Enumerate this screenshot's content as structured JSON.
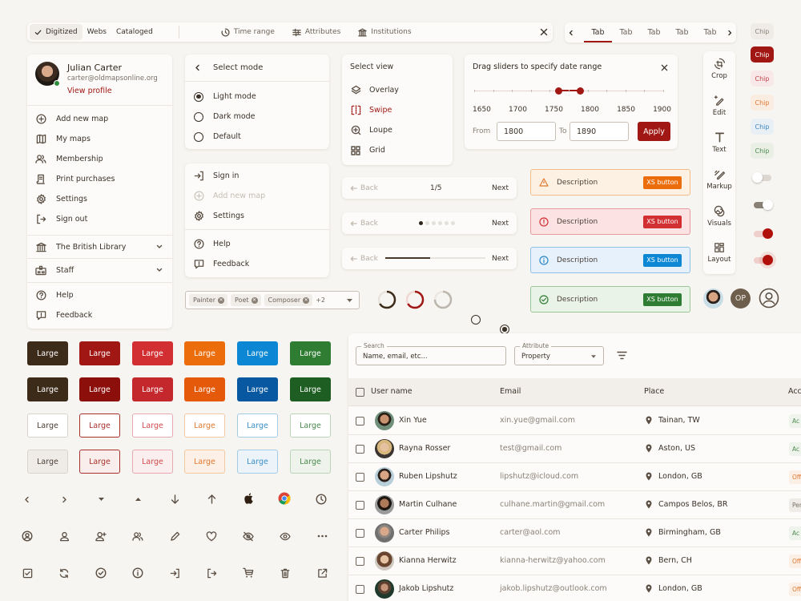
{
  "filterbar": {
    "chips": [
      {
        "label": "Digitized",
        "selected": true
      },
      {
        "label": "Webs",
        "selected": false
      },
      {
        "label": "Cataloged",
        "selected": false
      }
    ],
    "filters": [
      {
        "label": "Time range",
        "icon": "clock-icon"
      },
      {
        "label": "Attributes",
        "icon": "sliders-icon"
      },
      {
        "label": "Institutions",
        "icon": "institution-icon"
      }
    ]
  },
  "tabs": {
    "items": [
      "Tab",
      "Tab",
      "Tab",
      "Tab",
      "Tab"
    ],
    "active_index": 0
  },
  "chips": [
    {
      "label": "Chip",
      "variant": "neutral"
    },
    {
      "label": "Chip",
      "variant": "primary-filled"
    },
    {
      "label": "Chip",
      "variant": "red"
    },
    {
      "label": "Chip",
      "variant": "orange"
    },
    {
      "label": "Chip",
      "variant": "blue"
    },
    {
      "label": "Chip",
      "variant": "green"
    }
  ],
  "profile": {
    "name": "Julian Carter",
    "email": "carter@oldmapsonline.org",
    "view_profile": "View profile",
    "status": "online",
    "items": [
      "Add new map",
      "My maps",
      "Membership",
      "Print purchases",
      "Settings",
      "Sign out"
    ],
    "institution": "The British Library",
    "role": "Staff",
    "footer": [
      "Help",
      "Feedback"
    ]
  },
  "mode_menu": {
    "title": "Select mode",
    "options": [
      "Light mode",
      "Dark mode",
      "Default"
    ],
    "selected_index": 0
  },
  "menu2": {
    "items": [
      {
        "label": "Sign in",
        "disabled": false
      },
      {
        "label": "Add new map",
        "disabled": true
      },
      {
        "label": "Settings",
        "disabled": false
      }
    ],
    "footer": [
      "Help",
      "Feedback"
    ]
  },
  "view_menu": {
    "title": "Select view",
    "options": [
      "Overlay",
      "Swipe",
      "Loupe",
      "Grid"
    ],
    "active_index": 1
  },
  "date_range": {
    "title": "Drag sliders to specify date range",
    "ticks": [
      "1650",
      "1700",
      "1750",
      "1800",
      "1850",
      "1900"
    ],
    "range_min": 1650,
    "range_max": 1900,
    "handle_low": 1762,
    "handle_high": 1790,
    "from_label": "From",
    "from_value": "1800",
    "to_label": "To",
    "to_value": "1890",
    "apply": "Apply"
  },
  "tools": [
    "Crop",
    "Edit",
    "Text",
    "Markup",
    "Visuals",
    "Layout"
  ],
  "toggles": [
    {
      "on": false,
      "disabled": true
    },
    {
      "on": true,
      "disabled": true
    },
    {
      "on": true,
      "disabled": false
    },
    {
      "on": true,
      "disabled": false,
      "focused": true
    }
  ],
  "pagers": [
    {
      "back": "Back",
      "next": "Next",
      "type": "count",
      "current": "1/5"
    },
    {
      "back": "Back",
      "next": "Next",
      "type": "dots",
      "dots": 6,
      "active_dot": 0
    },
    {
      "back": "Back",
      "next": "Next",
      "type": "progress",
      "progress": 0.45
    }
  ],
  "alerts": [
    {
      "type": "warning",
      "text": "Description",
      "button": "XS button"
    },
    {
      "type": "error",
      "text": "Description",
      "button": "XS button"
    },
    {
      "type": "info",
      "text": "Description",
      "button": "XS button"
    },
    {
      "type": "success",
      "text": "Description",
      "button": "XS button"
    }
  ],
  "multiselect": {
    "tags": [
      "Painter",
      "Poet",
      "Composer"
    ],
    "more": "+2"
  },
  "spinners": [
    {
      "color": "dark"
    },
    {
      "color": "red"
    },
    {
      "color": "gray"
    }
  ],
  "avatars": {
    "initials": "OP"
  },
  "buttons": {
    "label": "Large",
    "colors": [
      "#3d2b1a",
      "#a11713",
      "#d22f33",
      "#ec6d0b",
      "#0b87d4",
      "#2e7d32"
    ],
    "hover_colors": [
      "#3d2b1a",
      "#8c0f0c",
      "#c4282d",
      "#e55a0a",
      "#0758a0",
      "#1f5e22"
    ],
    "outline_text": [
      "#4a3f35",
      "#a6302b",
      "#cf4b4f",
      "#e0792e",
      "#3a8fc9",
      "#4a8a4d"
    ]
  },
  "icons_grid": [
    [
      "chevron-left-icon",
      "chevron-right-icon",
      "caret-down-icon",
      "caret-up-icon",
      "arrow-down-icon",
      "arrow-up-icon",
      "apple-icon",
      "chrome-icon",
      "clock-icon"
    ],
    [
      "user-circle-icon",
      "user-icon",
      "user-add-icon",
      "users-icon",
      "pencil-icon",
      "heart-icon",
      "eye-off-icon",
      "eye-icon",
      "more-icon"
    ],
    [
      "checkbox-icon",
      "refresh-icon",
      "check-circle-icon",
      "info-icon",
      "sign-in-icon",
      "sign-out-icon",
      "cart-icon",
      "trash-icon",
      "external-link-icon"
    ]
  ],
  "table": {
    "search": {
      "label": "Search",
      "placeholder": "Name, email, etc..."
    },
    "attribute": {
      "label": "Attribute",
      "value": "Property"
    },
    "columns": [
      "User name",
      "Email",
      "Place",
      "Acc"
    ],
    "rows": [
      {
        "name": "Xin Yue",
        "email": "xin.yue@gmail.com",
        "place": "Tainan, TW",
        "status": "Ac",
        "status_type": "active"
      },
      {
        "name": "Rayna Rosser",
        "email": "test@gmail.com",
        "place": "Aston, US",
        "status": "Ac",
        "status_type": "active"
      },
      {
        "name": "Ruben Lipshutz",
        "email": "lipshutz@icloud.com",
        "place": "London, GB",
        "status": "Off",
        "status_type": "offline"
      },
      {
        "name": "Martin Culhane",
        "email": "culhane.martin@gmail.com",
        "place": "Campos Belos, BR",
        "status": "Per",
        "status_type": "pending"
      },
      {
        "name": "Carter Philips",
        "email": "carter@aol.com",
        "place": "Birmingham, GB",
        "status": "Ac",
        "status_type": "active"
      },
      {
        "name": "Kianna Herwitz",
        "email": "kianna-herwitz@yahoo.com",
        "place": "Bern, CH",
        "status": "Off",
        "status_type": "offline"
      },
      {
        "name": "Jakob Lipshutz",
        "email": "jakob.lipshutz@outlook.com",
        "place": "London, GB",
        "status": "Off",
        "status_type": "offline"
      }
    ]
  },
  "colors": {
    "brand": "#a11713",
    "text": "#3a3128",
    "background": "#f7f5f1"
  }
}
